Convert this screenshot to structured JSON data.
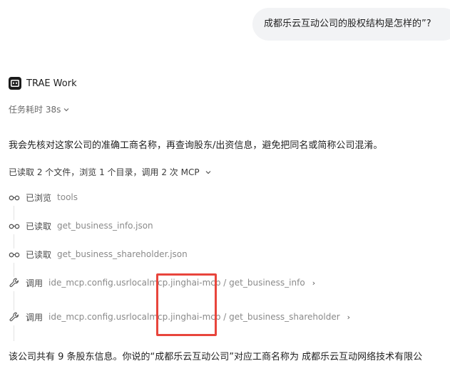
{
  "user_message": "成都乐云互动公司的股权结构是怎样的”?",
  "agent": {
    "name": "TRAE Work",
    "elapsed_label": "任务耗时 38s"
  },
  "lead_text": "我会先核对这家公司的准确工商名称，再查询股东/出资信息，避免把同名或简称公司混淆。",
  "summary_text": "已读取 2 个文件，浏览 1 个目录，调用 2 次 MCP",
  "steps": [
    {
      "icon": "glasses-icon",
      "action": "已浏览",
      "target": "tools"
    },
    {
      "icon": "glasses-icon",
      "action": "已读取",
      "target": "get_business_info.json"
    },
    {
      "icon": "glasses-icon",
      "action": "已读取",
      "target": "get_business_shareholder.json"
    },
    {
      "icon": "wrench-icon",
      "action": "调用",
      "target": "ide_mcp.config.usrlocalmcp.jinghai-mcp / get_business_info"
    },
    {
      "icon": "wrench-icon",
      "action": "调用",
      "target": "ide_mcp.config.usrlocalmcp.jinghai-mcp / get_business_shareholder"
    }
  ],
  "answer_text": "该公司共有 9 条股东信息。你说的“成都乐云互动公司”对应工商名称为 成都乐云互动网络技术有限公",
  "colors": {
    "highlight": "#e8453c",
    "bubble": "#f2f3f5"
  }
}
